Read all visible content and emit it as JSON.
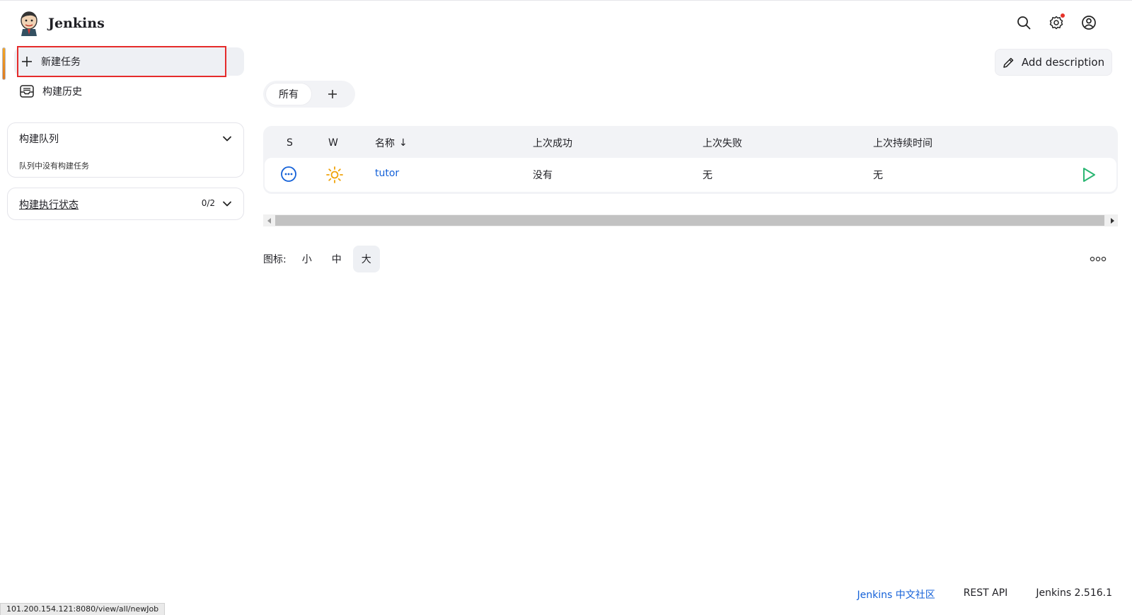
{
  "header": {
    "brand": "Jenkins",
    "icons": [
      "search-icon",
      "settings-icon",
      "user-icon"
    ]
  },
  "sidebar": {
    "new_task": "新建任务",
    "build_history": "构建历史",
    "build_queue": {
      "title": "构建队列",
      "empty": "队列中没有构建任务"
    },
    "executor_status": {
      "title": "构建执行状态",
      "count": "0/2"
    }
  },
  "main": {
    "add_description": "Add description",
    "tabs": {
      "all": "所有"
    },
    "table": {
      "headers": {
        "s": "S",
        "w": "W",
        "name": "名称",
        "sort_arrow": "↓",
        "last_success": "上次成功",
        "last_failure": "上次失败",
        "last_duration": "上次持续时间"
      },
      "rows": [
        {
          "name": "tutor",
          "last_success": "没有",
          "last_failure": "无",
          "last_duration": "无"
        }
      ]
    },
    "icon_size": {
      "label": "图标:",
      "small": "小",
      "medium": "中",
      "large": "大",
      "selected": "大"
    }
  },
  "footer": {
    "community": "Jenkins 中文社区",
    "rest_api": "REST API",
    "version": "Jenkins 2.516.1"
  },
  "status_url": "101.200.154.121:8080/view/all/newJob",
  "colors": {
    "link": "#1461d8",
    "highlight": "#e52b2b",
    "run": "#2bb673",
    "weather": "#f0a30a"
  }
}
